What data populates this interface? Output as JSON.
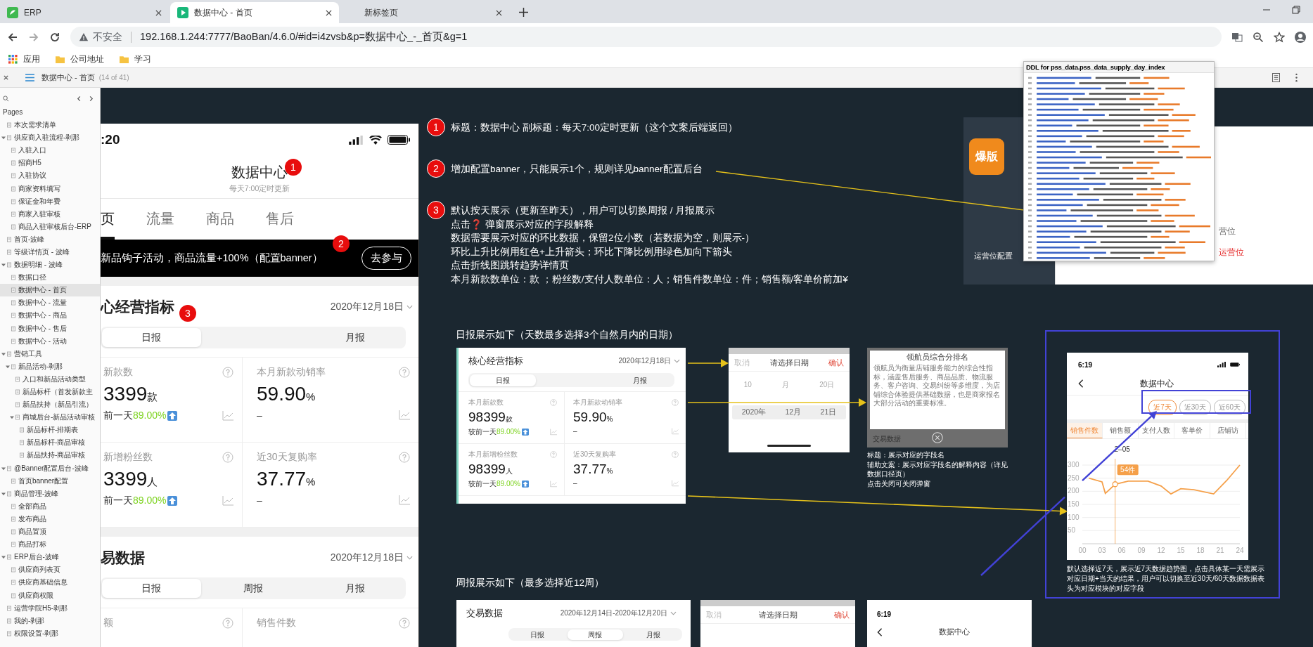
{
  "browser": {
    "tabs": [
      {
        "title": "ERP",
        "selected": false,
        "kind": "leaf"
      },
      {
        "title": "数据中心 - 首页",
        "selected": true,
        "kind": "play"
      },
      {
        "title": "新标签页",
        "selected": false,
        "kind": "blank"
      }
    ],
    "security_label": "不安全",
    "url": "192.168.1.244:7777/BaoBan/4.6.0/#id=i4zvsb&p=数据中心_-_首页&g=1",
    "bookmarks": [
      {
        "label": "应用",
        "kind": "apps"
      },
      {
        "label": "公司地址",
        "kind": "folder"
      },
      {
        "label": "学习",
        "kind": "folder"
      }
    ]
  },
  "viewer": {
    "page_title": "数据中心 - 首页",
    "page_count": "(14 of 41)"
  },
  "sidebar": {
    "heading": "Pages",
    "items": [
      {
        "label": "本次需求清单",
        "selected": false
      },
      {
        "label": "供应商入驻流程-剥那",
        "selected": false,
        "expanded": true,
        "children": [
          {
            "label": "入驻入口",
            "selected": false
          },
          {
            "label": "招商H5",
            "selected": false
          },
          {
            "label": "入驻协议",
            "selected": false
          },
          {
            "label": "商家资料填写",
            "selected": false
          },
          {
            "label": "保证金和年费",
            "selected": false
          },
          {
            "label": "商家入驻审核",
            "selected": false
          },
          {
            "label": "商品入驻审核后台-ERP",
            "selected": false
          }
        ]
      },
      {
        "label": "首页-波峰",
        "selected": false
      },
      {
        "label": "等级详情页 - 波峰",
        "selected": false
      },
      {
        "label": "数据明细 - 波峰",
        "selected": false,
        "expanded": true,
        "children": [
          {
            "label": "数据口径",
            "selected": false
          },
          {
            "label": "数据中心 - 首页",
            "selected": true
          },
          {
            "label": "数据中心 - 流量",
            "selected": false
          },
          {
            "label": "数据中心 - 商品",
            "selected": false
          },
          {
            "label": "数据中心 - 售后",
            "selected": false
          },
          {
            "label": "数据中心 - 活动",
            "selected": false
          }
        ]
      },
      {
        "label": "营销工具",
        "selected": false,
        "expanded": true,
        "children": [
          {
            "label": "新品活动-剥那",
            "selected": false,
            "expanded": true,
            "children": [
              {
                "label": "入口和新品活动类型",
                "selected": false
              },
              {
                "label": "新品标杆（首发新款主",
                "selected": false
              },
              {
                "label": "新品扶持（新品引流）",
                "selected": false
              },
              {
                "label": "商城后台-新品活动审核",
                "selected": false,
                "expanded": true,
                "children": [
                  {
                    "label": "新品标杆-排期表",
                    "selected": false
                  },
                  {
                    "label": "新品标杆-商品审核",
                    "selected": false
                  },
                  {
                    "label": "新品扶持-商品审核",
                    "selected": false
                  }
                ]
              }
            ]
          }
        ]
      },
      {
        "label": "@Banner配置后台-波峰",
        "selected": false,
        "expanded": true,
        "children": [
          {
            "label": "首页banner配置",
            "selected": false
          }
        ]
      },
      {
        "label": "商品管理-波峰",
        "selected": false,
        "expanded": true,
        "children": [
          {
            "label": "全部商品",
            "selected": false
          },
          {
            "label": "发布商品",
            "selected": false
          },
          {
            "label": "商品置顶",
            "selected": false
          },
          {
            "label": "商品打标",
            "selected": false
          }
        ]
      },
      {
        "label": "ERP后台-波峰",
        "selected": false,
        "expanded": true,
        "children": [
          {
            "label": "供应商列表页",
            "selected": false
          },
          {
            "label": "供应商基础信息",
            "selected": false
          },
          {
            "label": "供应商权限",
            "selected": false
          }
        ]
      },
      {
        "label": "运营学院H5-剥那",
        "selected": false
      },
      {
        "label": "我的-剥那",
        "selected": false
      },
      {
        "label": "权限设置-剥那",
        "selected": false
      }
    ]
  },
  "phone": {
    "time": ":20",
    "title": "数据中心",
    "subtitle": "每天7:00定时更新",
    "tabs": [
      {
        "label": "页",
        "selected": true
      },
      {
        "label": "流量",
        "selected": false
      },
      {
        "label": "商品",
        "selected": false
      },
      {
        "label": "售后",
        "selected": false
      }
    ],
    "banner": {
      "text": "新品钩子活动，商品流量+100%（配置banner）",
      "button": "去参与"
    },
    "markers": [
      {
        "number": "1"
      },
      {
        "number": "2"
      },
      {
        "number": "3"
      }
    ],
    "sections": [
      {
        "title": "心经营指标",
        "date": "2020年12月18日",
        "segments": [
          {
            "label": "日报",
            "selected": true
          },
          {
            "label": "月报",
            "selected": false
          }
        ],
        "metrics": [
          {
            "label": "新款数",
            "value": "3399",
            "unit": "款",
            "compare_label": "前一天",
            "compare": "89.00%",
            "rising": true
          },
          {
            "label": "本月新款动销率",
            "value": "59.90",
            "unit": "%",
            "compare": "–"
          },
          {
            "label": "新增粉丝数",
            "value": "3399",
            "unit": "人",
            "compare_label": "前一天",
            "compare": "89.00%",
            "rising": true
          },
          {
            "label": "近30天复购率",
            "value": "37.77",
            "unit": "%",
            "compare": "–"
          }
        ]
      },
      {
        "title": "易数据",
        "date": "2020年12月18日",
        "segments": [
          {
            "label": "日报",
            "selected": true
          },
          {
            "label": "周报",
            "selected": false
          },
          {
            "label": "月报",
            "selected": false
          }
        ],
        "metrics": [
          {
            "label": "额"
          },
          {
            "label": "销售件数"
          }
        ]
      }
    ]
  },
  "notes": [
    {
      "number": "1",
      "lines": [
        "标题：数据中心 副标题：每天7:00定时更新（这个文案后端返回）"
      ]
    },
    {
      "number": "2",
      "lines": [
        "增加配置banner，只能展示1个，规则详见banner配置后台"
      ]
    },
    {
      "number": "3",
      "lines": [
        "默认按天展示（更新至昨天），用户可以切换周报 / 月报展示",
        "点击❓ 弹窗展示对应的字段解释",
        "数据需要展示对应的环比数据，保留2位小数（若数据为空，则展示-）",
        "环比上升比例用红色+上升箭头；环比下降比例用绿色加向下箭头",
        "点击折线图跳转趋势详情页",
        "本月新款数单位：款 ；粉丝数/支付人数单位：人；销售件数单位：件；销售额/客单价前加¥"
      ]
    }
  ],
  "daily": {
    "heading": "日报展示如下（天数最多选择3个自然月内的日期）",
    "card": {
      "title": "核心经营指标",
      "date": "2020年12月18日",
      "segments": [
        {
          "label": "日报",
          "selected": true
        },
        {
          "label": "月报",
          "selected": false
        }
      ],
      "metrics": [
        {
          "label": "本月新款数",
          "value": "98399",
          "unit": "款",
          "compare_label": "较前一天",
          "compare": "89.00%",
          "rising": true
        },
        {
          "label": "本月新款动销率",
          "value": "59.90",
          "unit": "%",
          "compare": "–"
        },
        {
          "label": "本月新增粉丝数",
          "value": "98399",
          "unit": "人",
          "compare_label": "较前一天",
          "compare": "89.00%",
          "rising": true
        },
        {
          "label": "近30天复购率",
          "value": "37.77",
          "unit": "%",
          "compare": "–"
        }
      ]
    },
    "picker": {
      "cancel": "取消",
      "title": "请选择日期",
      "confirm": "确认",
      "columns": [
        {
          "above": "10",
          "selected": "2020年"
        },
        {
          "above": "月",
          "selected": "12月"
        },
        {
          "above": "20日",
          "selected": "21日"
        }
      ]
    },
    "popup": {
      "title": "领航员综合分排名",
      "body": "领航员为衡量店铺服务能力的综合性指标，涵盖售后服务、商品品质、物流服务、客户咨询、交易纠纷等多维度，为店铺综合体验提供基础数据，也是商家报名大部分活动的重要标准。",
      "behind": "交易数据"
    },
    "caption": [
      "标题：展示对应的字段名",
      "辅助文案：展示对应字段名的解释内容（详见数据口径页）",
      "点击关闭可关闭弹窗"
    ]
  },
  "weekly": {
    "heading": "周报展示如下（最多选择近12周）",
    "card": {
      "title": "交易数据",
      "date": "2020年12月14日-2020年12月20日",
      "segments": [
        {
          "label": "日报",
          "selected": false
        },
        {
          "label": "周报",
          "selected": true
        },
        {
          "label": "月报",
          "selected": false
        }
      ]
    },
    "picker": {
      "cancel": "取消",
      "title": "请选择日期",
      "confirm": "确认"
    },
    "phone": {
      "time": "6:19",
      "title": "数据中心"
    }
  },
  "backdrop": {
    "logo": "爆版",
    "menu_item": "运营位配置",
    "table_header": "营位",
    "table_cell": "运营位"
  },
  "ddl": {
    "title": "DDL for pss_data.pss_data_supply_day_index"
  },
  "trend": {
    "time": "6:19",
    "title": "数据中心",
    "ranges": [
      {
        "label": "近7天",
        "selected": true
      },
      {
        "label": "近30天",
        "selected": false
      },
      {
        "label": "近60天",
        "selected": false
      }
    ],
    "tabs": [
      {
        "label": "销售件数",
        "selected": true
      },
      {
        "label": "销售额",
        "selected": false
      },
      {
        "label": "支付人数",
        "selected": false
      },
      {
        "label": "客单价",
        "selected": false
      },
      {
        "label": "店铺访",
        "selected": false
      }
    ],
    "tooltip_date": "2–05",
    "chart_data": {
      "type": "line",
      "x": [
        1,
        3,
        3.5,
        5,
        7,
        10,
        12,
        13.5,
        15,
        17,
        20,
        22,
        24
      ],
      "grid": true,
      "series": [
        {
          "color": "#f5a04a",
          "values": [
            250,
            236,
            192,
            227,
            239,
            239,
            220,
            190,
            210,
            206,
            190,
            241,
            300
          ]
        }
      ],
      "xlim": [
        0,
        24
      ],
      "ylim": [
        0,
        300
      ],
      "xticks": [
        {
          "value": 0,
          "label": "00"
        },
        {
          "value": 3,
          "label": "03"
        },
        {
          "value": 6,
          "label": "06"
        },
        {
          "value": 9,
          "label": "09"
        },
        {
          "value": 12,
          "label": "12"
        },
        {
          "value": 15,
          "label": "15"
        },
        {
          "value": 18,
          "label": "18"
        },
        {
          "value": 21,
          "label": "21"
        },
        {
          "value": 24,
          "label": "24"
        }
      ],
      "yticks": [
        50,
        100,
        150,
        200,
        250,
        300
      ],
      "ref_lines": [
        {
          "axis": "x",
          "value": 5
        }
      ],
      "annotations": [
        {
          "x": 5,
          "y": 227,
          "text": "54件"
        }
      ]
    },
    "caption": "默认选择近7天，展示近7天数据趋势图，点击具体某一天需展示对应日期+当天的结果，用户可以切换至近30天/60天数据数据表头为对应模块的对应字段"
  }
}
